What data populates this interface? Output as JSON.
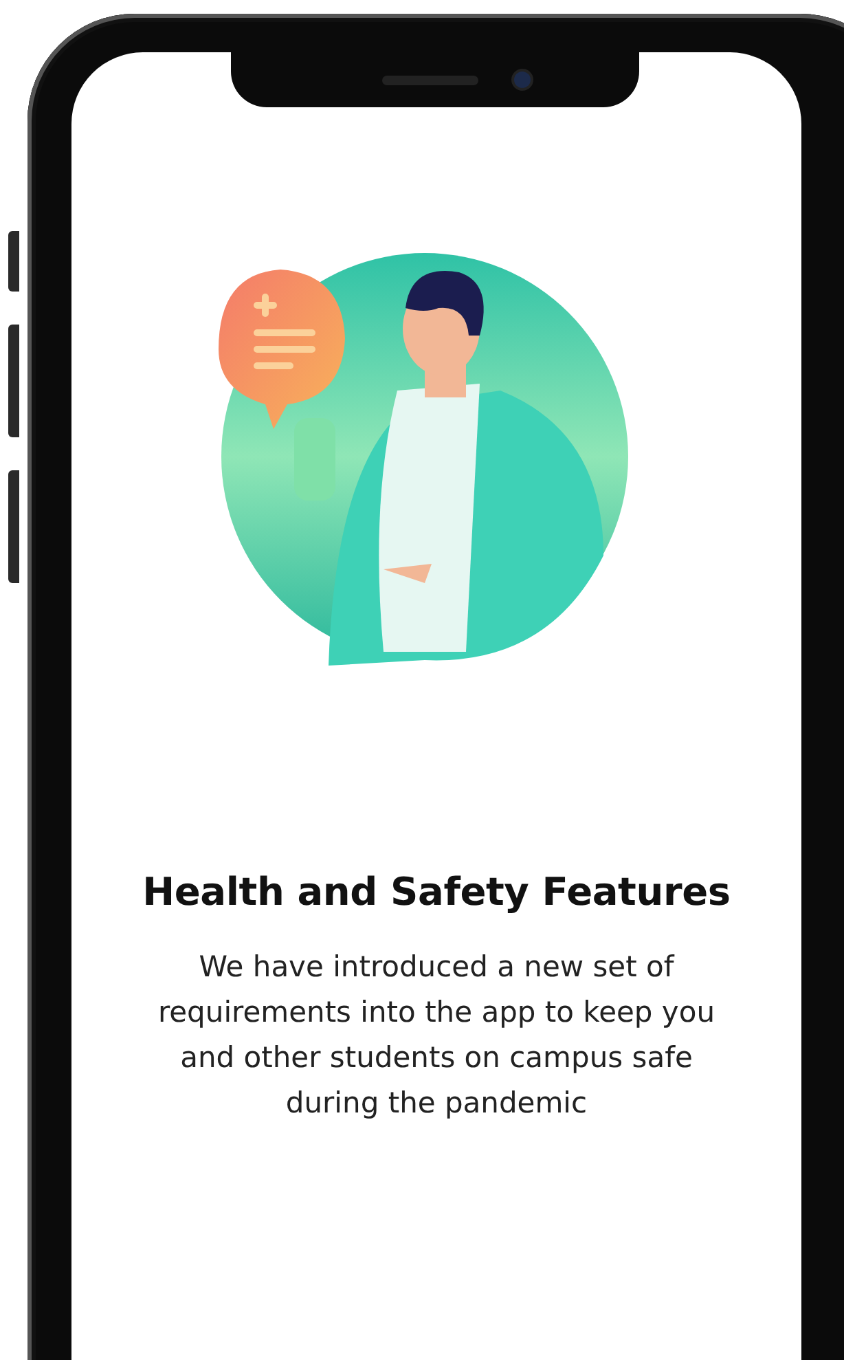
{
  "screen": {
    "title": "Health and Safety Features",
    "description": "We have introduced a new set of requirements into the app to keep you and other students on campus safe during the pandemic"
  }
}
